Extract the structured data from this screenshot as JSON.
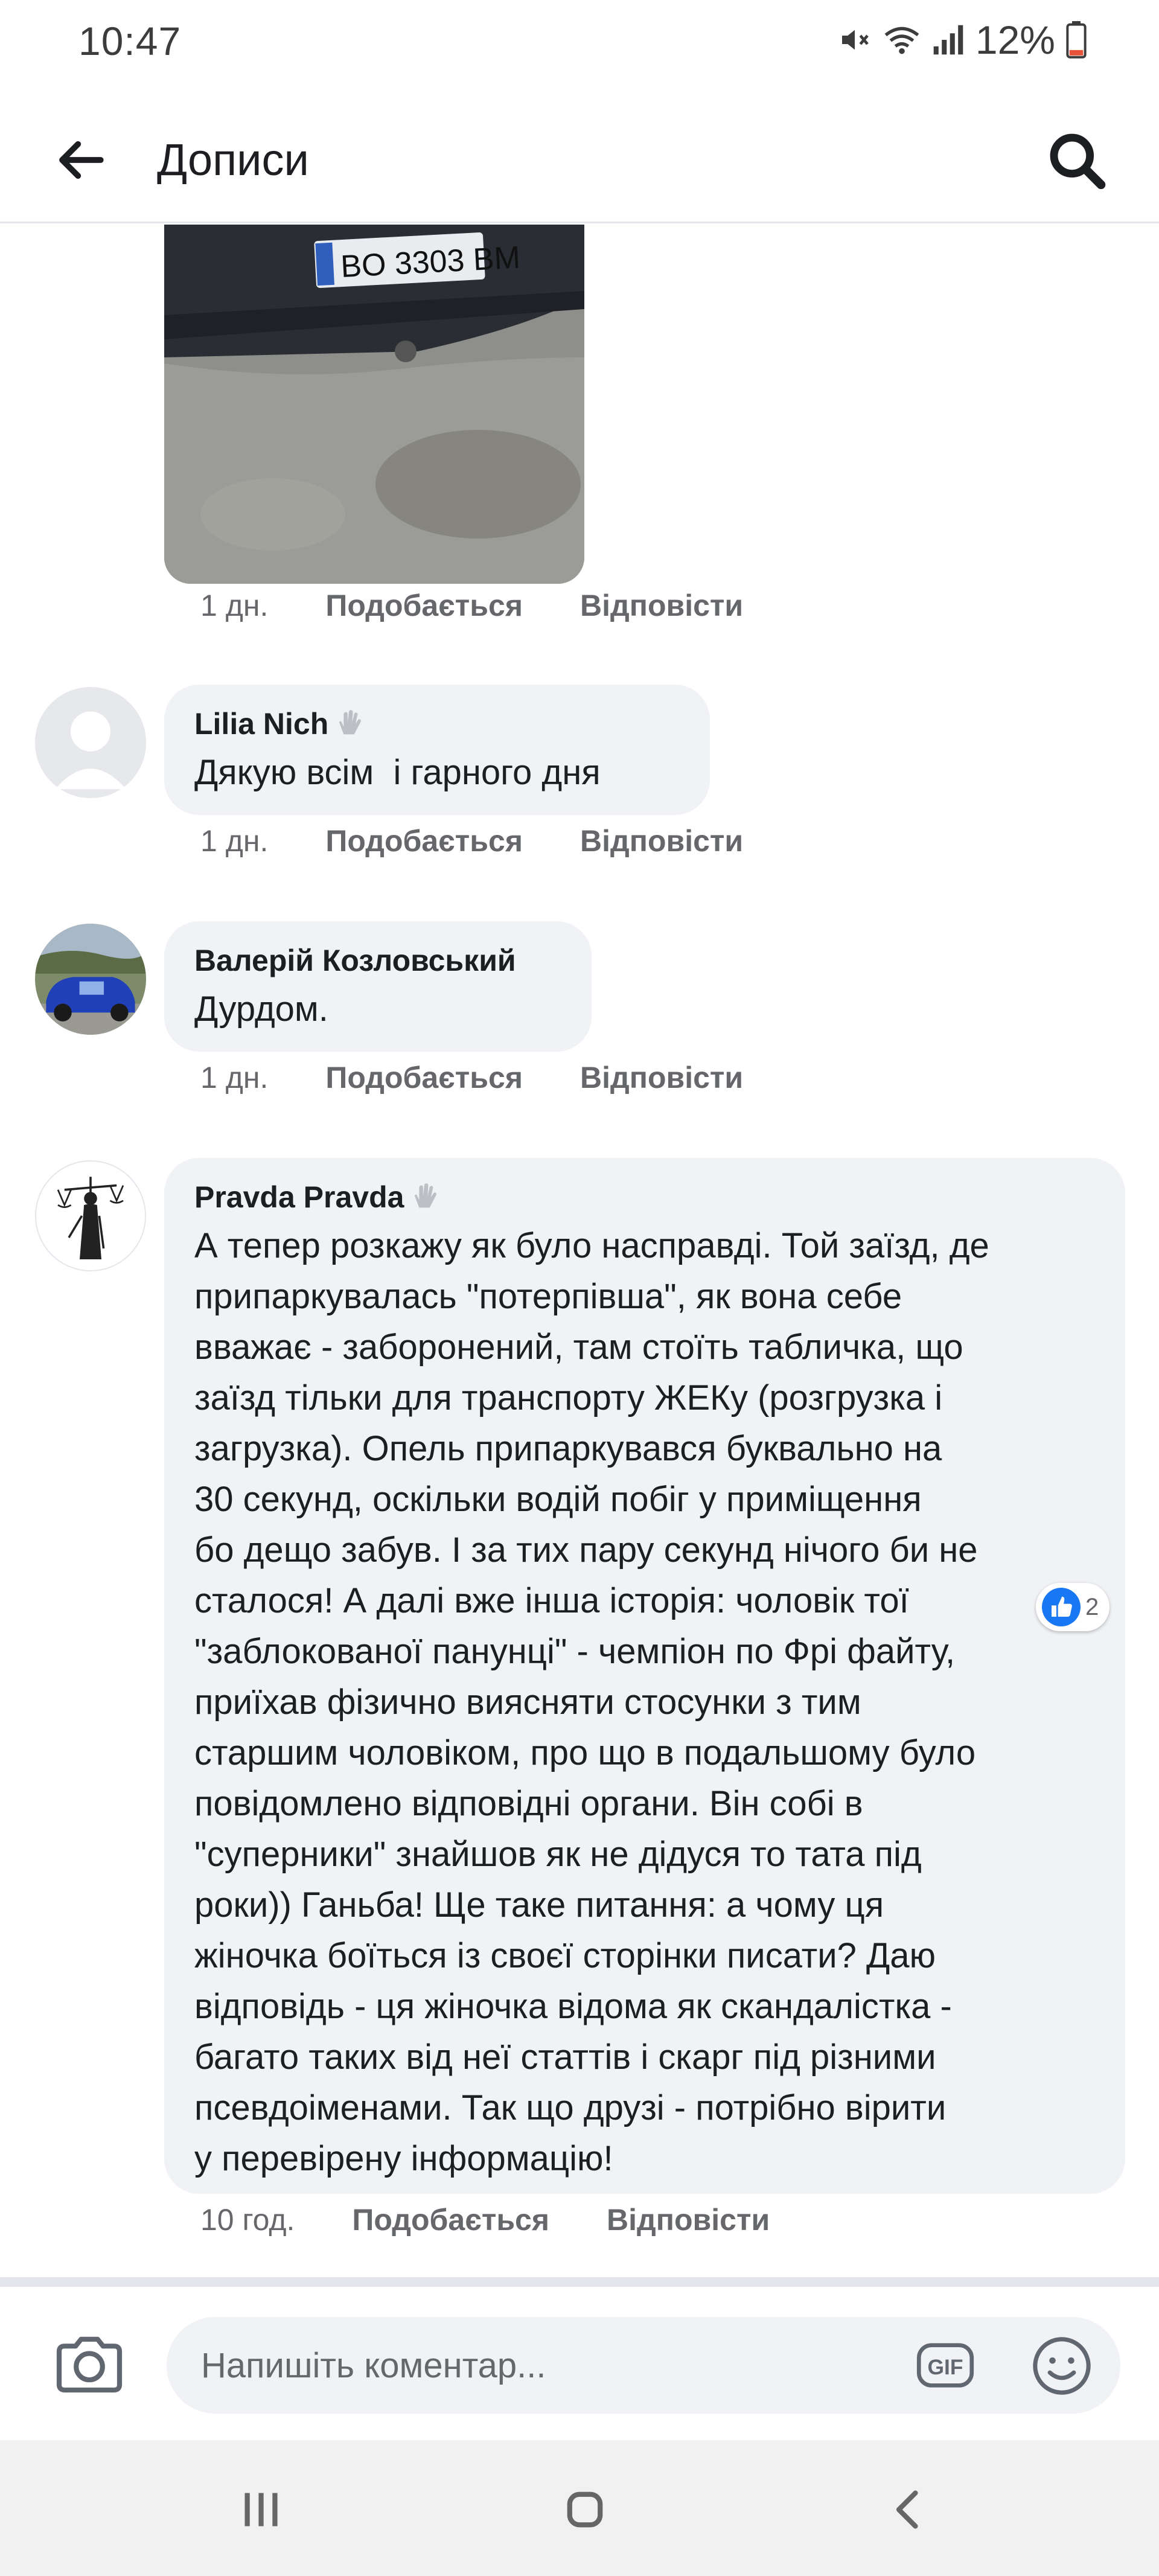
{
  "status_bar": {
    "time": "10:47",
    "battery": "12%",
    "icons": [
      "mute-icon",
      "wifi-icon",
      "signal-icon",
      "battery-icon"
    ]
  },
  "header": {
    "title": "Дописи",
    "back_icon": "arrow-left-icon",
    "search_icon": "search-icon"
  },
  "photo": {
    "plate": "BO 3303 BM"
  },
  "photo_meta": {
    "time": "1 дн.",
    "like": "Подобається",
    "reply": "Відповісти"
  },
  "comments": [
    {
      "author": "Lilia Nich",
      "wave": true,
      "text": "Дякую всім  і гарного дня",
      "time": "1 дн.",
      "like": "Подобається",
      "reply": "Відповісти"
    },
    {
      "author": "Валерій Козловський",
      "wave": false,
      "text": "Дурдом.",
      "time": "1 дн.",
      "like": "Подобається",
      "reply": "Відповісти"
    },
    {
      "author": "Pravda Pravda",
      "wave": true,
      "text": "А тепер розкажу як було насправді. Той заїзд, де\nприпаркувалась \"потерпівша\", як вона себе\nвважає - заборонений, там стоїть табличка, що\nзаїзд тільки для транспорту ЖЕКу (розгрузка і\nзагрузка). Опель припаркувався буквально на\n30 секунд, оскільки водій побіг у приміщення\nбо дещо забув. І за тих пару секунд нічого би не\nсталося! А далі вже інша історія: чоловік тої\n\"заблокованої панунці\" - чемпіон по Фрі файту,\nприїхав фізично виясняти стосунки з тим\nстаршим чоловіком, про що в подальшому було\nповідомлено відповідні органи. Він собі в\n\"суперники\" знайшов як не дідуся то тата під\nроки)) Ганьба! Ще таке питання: а чому ця\nжіночка боїться із своєї сторінки писати? Даю\nвідповідь - ця жіночка відома як скандалістка -\nбагато таких від неї статтів і скарг під різними\nпсевдоіменами. Так що друзі - потрібно вірити\nу перевірену інформацію!",
      "time": "10 год.",
      "like": "Подобається",
      "reply": "Відповісти",
      "reactions": "2"
    }
  ],
  "composer": {
    "placeholder": "Напишіть коментар...",
    "camera_icon": "camera-icon",
    "gif_label": "GIF",
    "emoji_icon": "emoji-icon"
  },
  "navbar": {
    "icons": [
      "recent-apps-icon",
      "home-icon",
      "back-icon"
    ]
  },
  "colors": {
    "bubble": "#f0f2f5",
    "meta_text": "#65676b",
    "like_blue": "#1877f2"
  }
}
